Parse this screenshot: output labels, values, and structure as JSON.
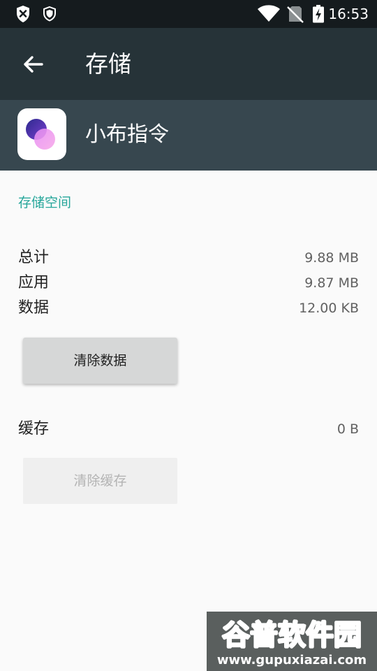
{
  "status_bar": {
    "time": "16:53",
    "icons": [
      "notification-x-icon",
      "shield-icon",
      "wifi-icon",
      "no-sim-icon",
      "battery-charging-icon"
    ]
  },
  "toolbar": {
    "title": "存储",
    "back_icon": "arrow-back-icon"
  },
  "app": {
    "name": "小布指令",
    "icon": "app-icon-overlapping-circles"
  },
  "storage": {
    "section_title": "存储空间",
    "rows": [
      {
        "label": "总计",
        "value": "9.88 MB"
      },
      {
        "label": "应用",
        "value": "9.87 MB"
      },
      {
        "label": "数据",
        "value": "12.00 KB"
      }
    ],
    "clear_data_label": "清除数据"
  },
  "cache": {
    "label": "缓存",
    "value": "0 B",
    "clear_cache_label": "清除缓存",
    "clear_cache_enabled": false
  },
  "watermark": {
    "logo_text": "谷普软件园",
    "url": "www.gupuxiazai.com"
  },
  "colors": {
    "status_bar": "#151b1e",
    "toolbar": "#263338",
    "app_header": "#37474f",
    "accent": "#26a69a",
    "background": "#fafafa"
  }
}
